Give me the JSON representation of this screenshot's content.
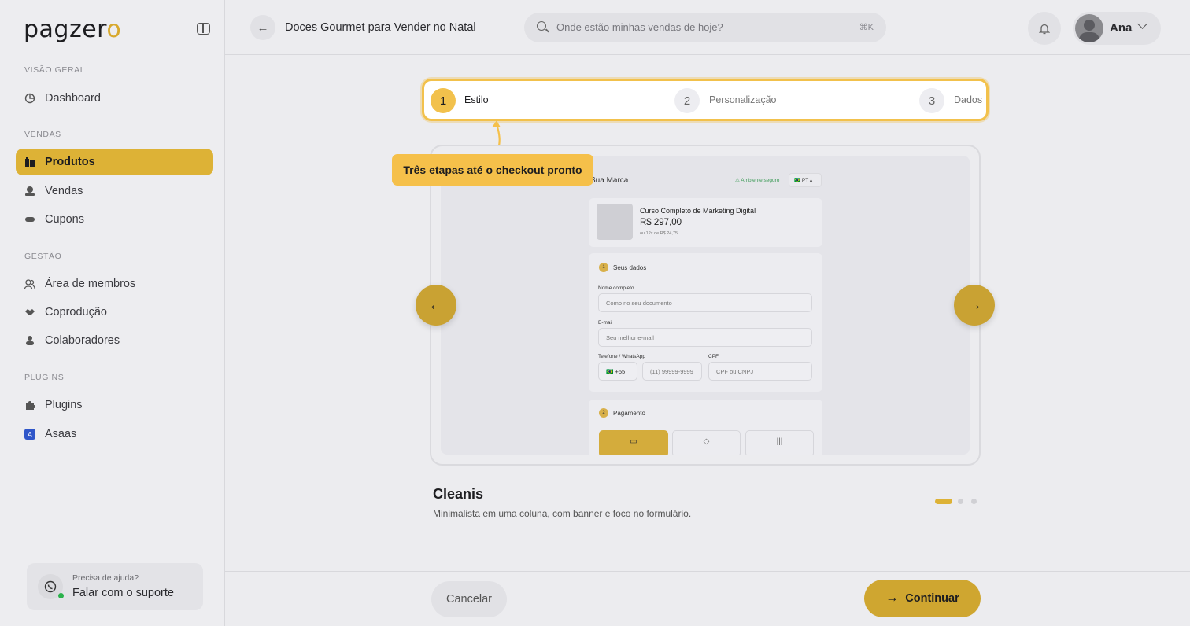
{
  "brand": {
    "logo_text": "pagzer",
    "logo_accent": "o"
  },
  "sidebar": {
    "sections": [
      {
        "label": "VISÃO GERAL"
      },
      {
        "label": "VENDAS"
      },
      {
        "label": "GESTÃO"
      },
      {
        "label": "PLUGINS"
      }
    ],
    "items": [
      {
        "label": "Dashboard",
        "icon": "chart-pie-icon"
      },
      {
        "label": "Produtos",
        "icon": "products-icon",
        "active": true
      },
      {
        "label": "Vendas",
        "icon": "sales-icon"
      },
      {
        "label": "Cupons",
        "icon": "coupon-icon"
      },
      {
        "label": "Área de membros",
        "icon": "users-icon"
      },
      {
        "label": "Coprodução",
        "icon": "handshake-icon"
      },
      {
        "label": "Colaboradores",
        "icon": "user-icon"
      },
      {
        "label": "Plugins",
        "icon": "puzzle-icon"
      },
      {
        "label": "Asaas",
        "icon": "asaas-logo-icon"
      }
    ],
    "help": {
      "question": "Precisa de ajuda?",
      "link": "Falar com o suporte"
    }
  },
  "header": {
    "title": "Doces Gourmet para Vender no Natal",
    "search_placeholder": "Onde estão minhas vendas de hoje?",
    "search_shortcut": "⌘K",
    "user_name": "Ana"
  },
  "stepper": {
    "steps": [
      {
        "number": "1",
        "label": "Estilo",
        "active": true
      },
      {
        "number": "2",
        "label": "Personalização",
        "active": false
      },
      {
        "number": "3",
        "label": "Dados",
        "active": false
      }
    ]
  },
  "tooltip": {
    "text": "Três etapas até o checkout pronto"
  },
  "preview": {
    "brand": "Sua Marca",
    "secure": "Ambiente seguro",
    "lang": "PT",
    "product_name": "Curso Completo de Marketing Digital",
    "price": "R$ 297,00",
    "installments": "ou 12x de R$ 24,75",
    "section1": "Seus dados",
    "section1_num": "1",
    "name_label": "Nome completo",
    "name_ph": "Como no seu documento",
    "email_label": "E-mail",
    "email_ph": "Seu melhor e-mail",
    "phone_label": "Telefone / WhatsApp",
    "phone_code": "+55",
    "phone_ph": "(11) 99999-9999",
    "cpf_label": "CPF",
    "cpf_ph": "CPF ou CNPJ",
    "section2": "Pagamento",
    "section2_num": "2"
  },
  "template": {
    "name": "Cleanis",
    "description": "Minimalista em uma coluna, com banner e foco no formulário.",
    "page_count": 3,
    "current_page": 1
  },
  "footer": {
    "cancel": "Cancelar",
    "continue": "Continuar"
  },
  "colors": {
    "accent": "#DDB236",
    "stepper_border": "#F2C14C",
    "background": "#ECECEF"
  }
}
